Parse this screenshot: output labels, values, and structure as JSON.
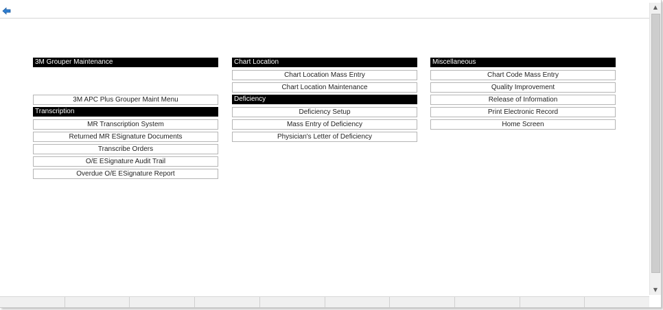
{
  "sections": {
    "grouper": {
      "header": "3M Grouper Maintenance",
      "items": [
        "3M APC Plus Grouper Maint Menu"
      ]
    },
    "transcription": {
      "header": "Transcription",
      "items": [
        "MR Transcription System",
        "Returned MR ESignature Documents",
        "Transcribe Orders",
        "O/E ESignature Audit Trail",
        "Overdue O/E ESignature Report"
      ]
    },
    "chart_location": {
      "header": "Chart Location",
      "items": [
        "Chart Location Mass Entry",
        "Chart Location Maintenance"
      ]
    },
    "deficiency": {
      "header": "Deficiency",
      "items": [
        "Deficiency Setup",
        "Mass Entry of Deficiency",
        "Physician's Letter of Deficiency"
      ]
    },
    "miscellaneous": {
      "header": "Miscellaneous",
      "items": [
        "Chart Code Mass Entry",
        "Quality Improvement",
        "Release of Information",
        "Print Electronic Record",
        "Home Screen"
      ]
    }
  },
  "icons": {
    "back": "back-arrow-icon",
    "scroll_up": "chevron-up-icon",
    "scroll_down": "chevron-down-icon"
  },
  "colors": {
    "header_bg": "#000000",
    "header_text": "#ffffff",
    "button_border": "#b4b4b4",
    "accent_icon": "#2f7fd1"
  }
}
